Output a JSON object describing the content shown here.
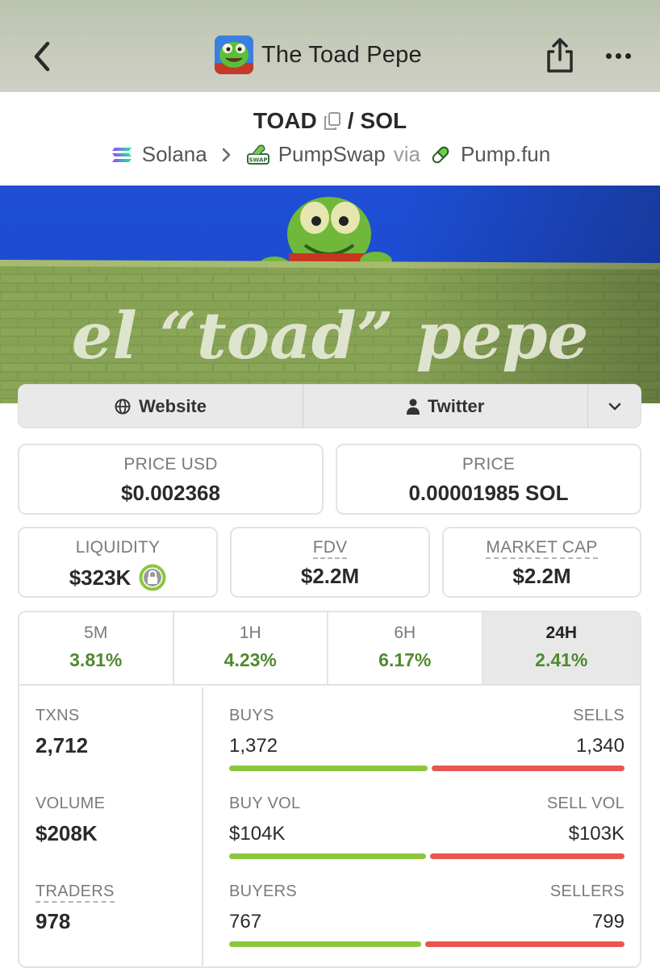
{
  "header": {
    "title": "The Toad Pepe"
  },
  "pair": {
    "base": "TOAD",
    "separator": "/",
    "quote": "SOL",
    "chain": "Solana",
    "dex": "PumpSwap",
    "via": "via",
    "launchpad": "Pump.fun"
  },
  "banner": {
    "text": "el “toad” pepe"
  },
  "links": {
    "website": "Website",
    "twitter": "Twitter"
  },
  "stats": {
    "price_usd_label": "PRICE USD",
    "price_usd": "$0.002368",
    "price_label": "PRICE",
    "price": "0.00001985 SOL",
    "liquidity_label": "LIQUIDITY",
    "liquidity": "$323K",
    "fdv_label": "FDV",
    "fdv": "$2.2M",
    "mcap_label": "MARKET CAP",
    "mcap": "$2.2M"
  },
  "timeframes": [
    {
      "label": "5M",
      "change": "3.81%"
    },
    {
      "label": "1H",
      "change": "4.23%"
    },
    {
      "label": "6H",
      "change": "6.17%"
    },
    {
      "label": "24H",
      "change": "2.41%"
    }
  ],
  "activity": {
    "txns_label": "TXNS",
    "txns": "2,712",
    "volume_label": "VOLUME",
    "volume": "$208K",
    "traders_label": "TRADERS",
    "traders": "978",
    "buys_label": "BUYS",
    "buys": "1,372",
    "sells_label": "SELLS",
    "sells": "1,340",
    "buys_fraction": 0.506,
    "buy_vol_label": "BUY VOL",
    "buy_vol": "$104K",
    "sell_vol_label": "SELL VOL",
    "sell_vol": "$103K",
    "buy_vol_fraction": 0.502,
    "buyers_label": "BUYERS",
    "buyers": "767",
    "sellers_label": "SELLERS",
    "sellers": "799",
    "buyers_fraction": 0.49
  },
  "colors": {
    "positive": "#4f8a2e",
    "buy_bar": "#8cc63f",
    "sell_bar": "#e85650"
  }
}
